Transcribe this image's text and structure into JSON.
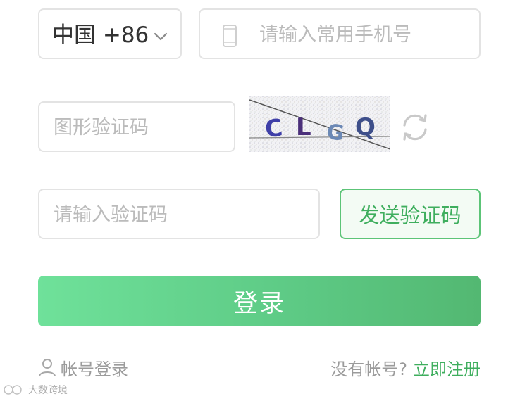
{
  "country_code": {
    "label": "中国 +86",
    "chevron_icon": "chevron-down-icon"
  },
  "phone_input": {
    "placeholder": "请输入常用手机号",
    "icon": "mobile-phone-icon"
  },
  "graphic_code_input": {
    "placeholder": "图形验证码"
  },
  "captcha": {
    "text": "CLGQ",
    "refresh_icon": "refresh-icon"
  },
  "sms_code_input": {
    "placeholder": "请输入验证码"
  },
  "send_code_button": {
    "label": "发送验证码"
  },
  "login_button": {
    "label": "登录"
  },
  "account_login_link": {
    "label": "帐号登录",
    "icon": "user-icon"
  },
  "register": {
    "question": "没有帐号?",
    "link_label": "立即注册"
  },
  "watermark": {
    "text": "大数跨境"
  },
  "colors": {
    "accent": "#3fae5e",
    "login_gradient_start": "#6fe19a",
    "login_gradient_end": "#53b872",
    "border": "#e3e3e3",
    "placeholder": "#bbbbbb"
  }
}
